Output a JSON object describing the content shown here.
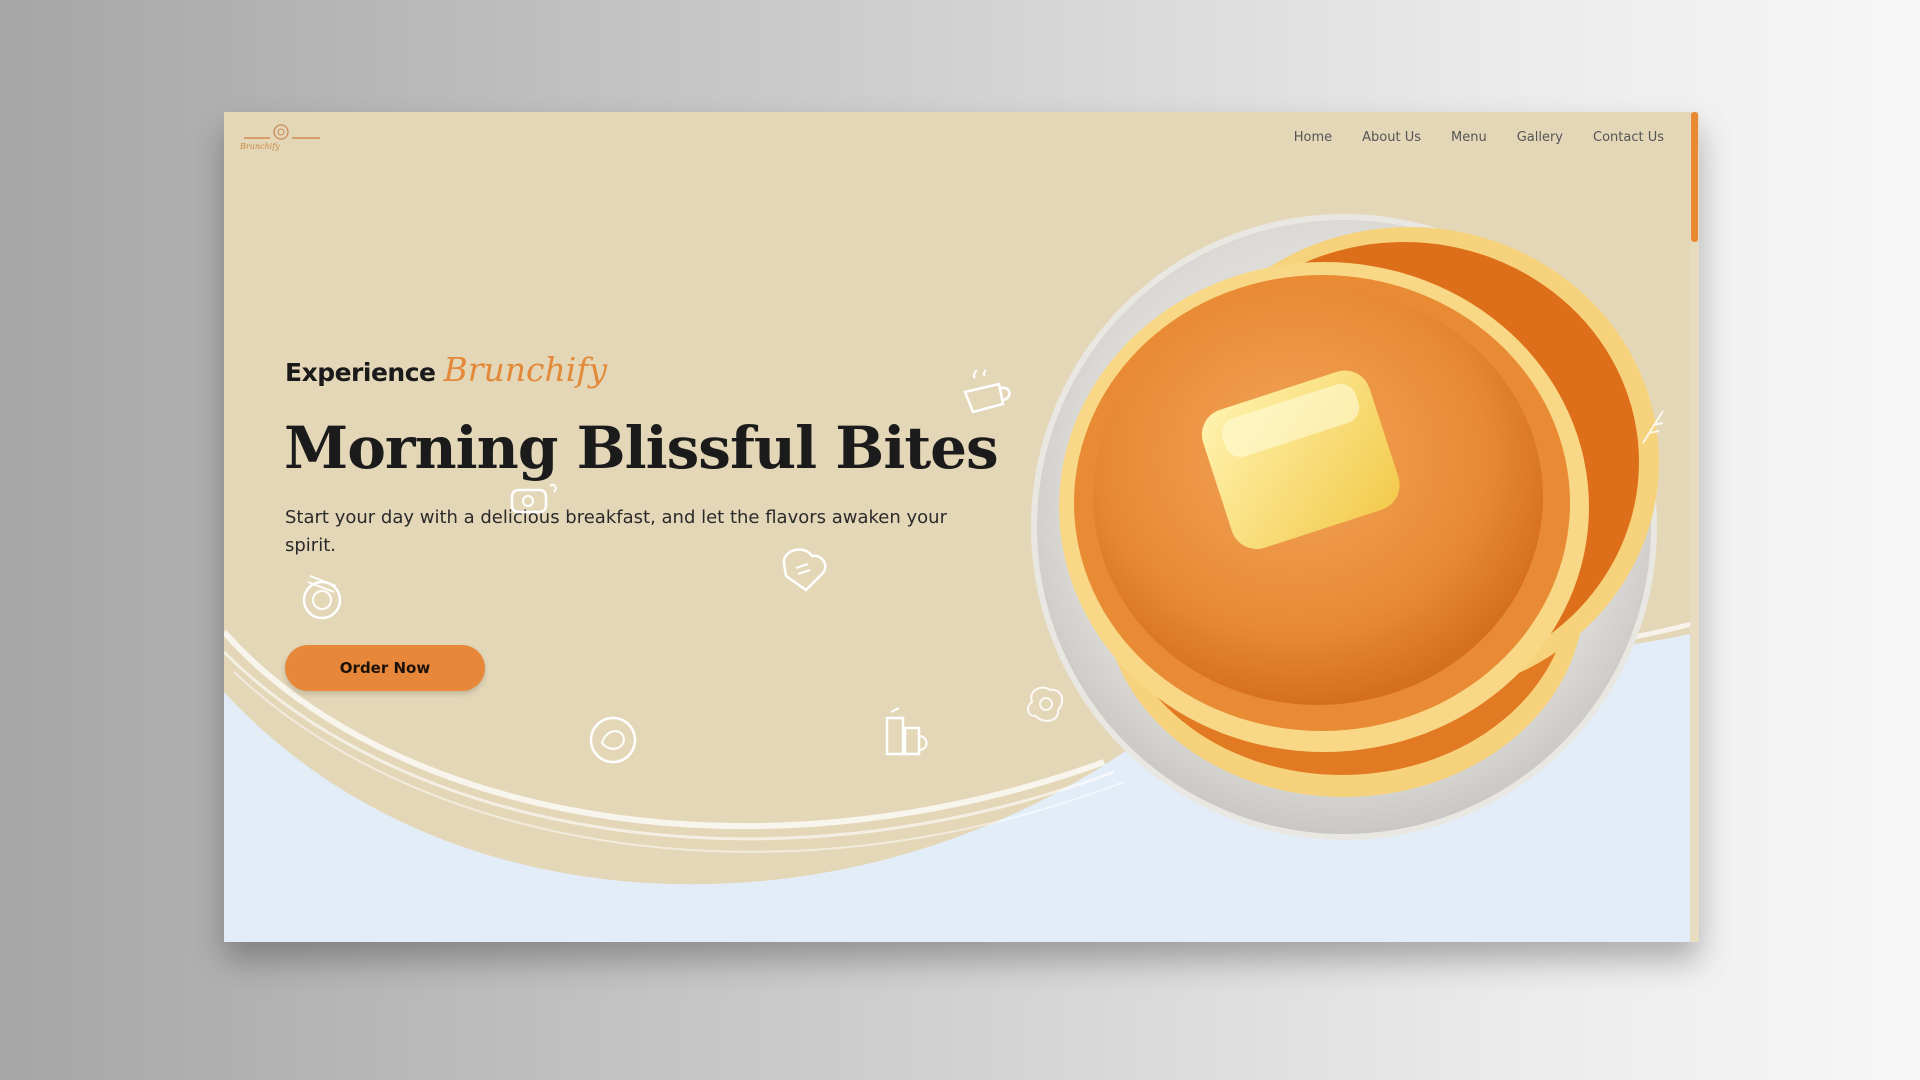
{
  "brand": {
    "logo_text": "Brunchify",
    "accent_color": "#e6873a"
  },
  "nav": {
    "items": [
      {
        "label": "Home"
      },
      {
        "label": "About Us"
      },
      {
        "label": "Menu"
      },
      {
        "label": "Gallery"
      },
      {
        "label": "Contact Us"
      }
    ]
  },
  "hero": {
    "eyebrow_plain": "Experience",
    "eyebrow_script": "Brunchify",
    "headline": "Morning Blissful Bites",
    "subtext": "Start your day with a delicious breakfast, and let the flavors awaken your spirit.",
    "cta_label": "Order Now"
  },
  "icons": {
    "coffee": "coffee-cup-icon",
    "toast": "toast-icon",
    "plate": "plate-icon",
    "egg": "fried-egg-icon",
    "breakfast": "breakfast-plate-icon",
    "drinks": "drinks-icon",
    "pancakes": "pancake-stack-image"
  }
}
